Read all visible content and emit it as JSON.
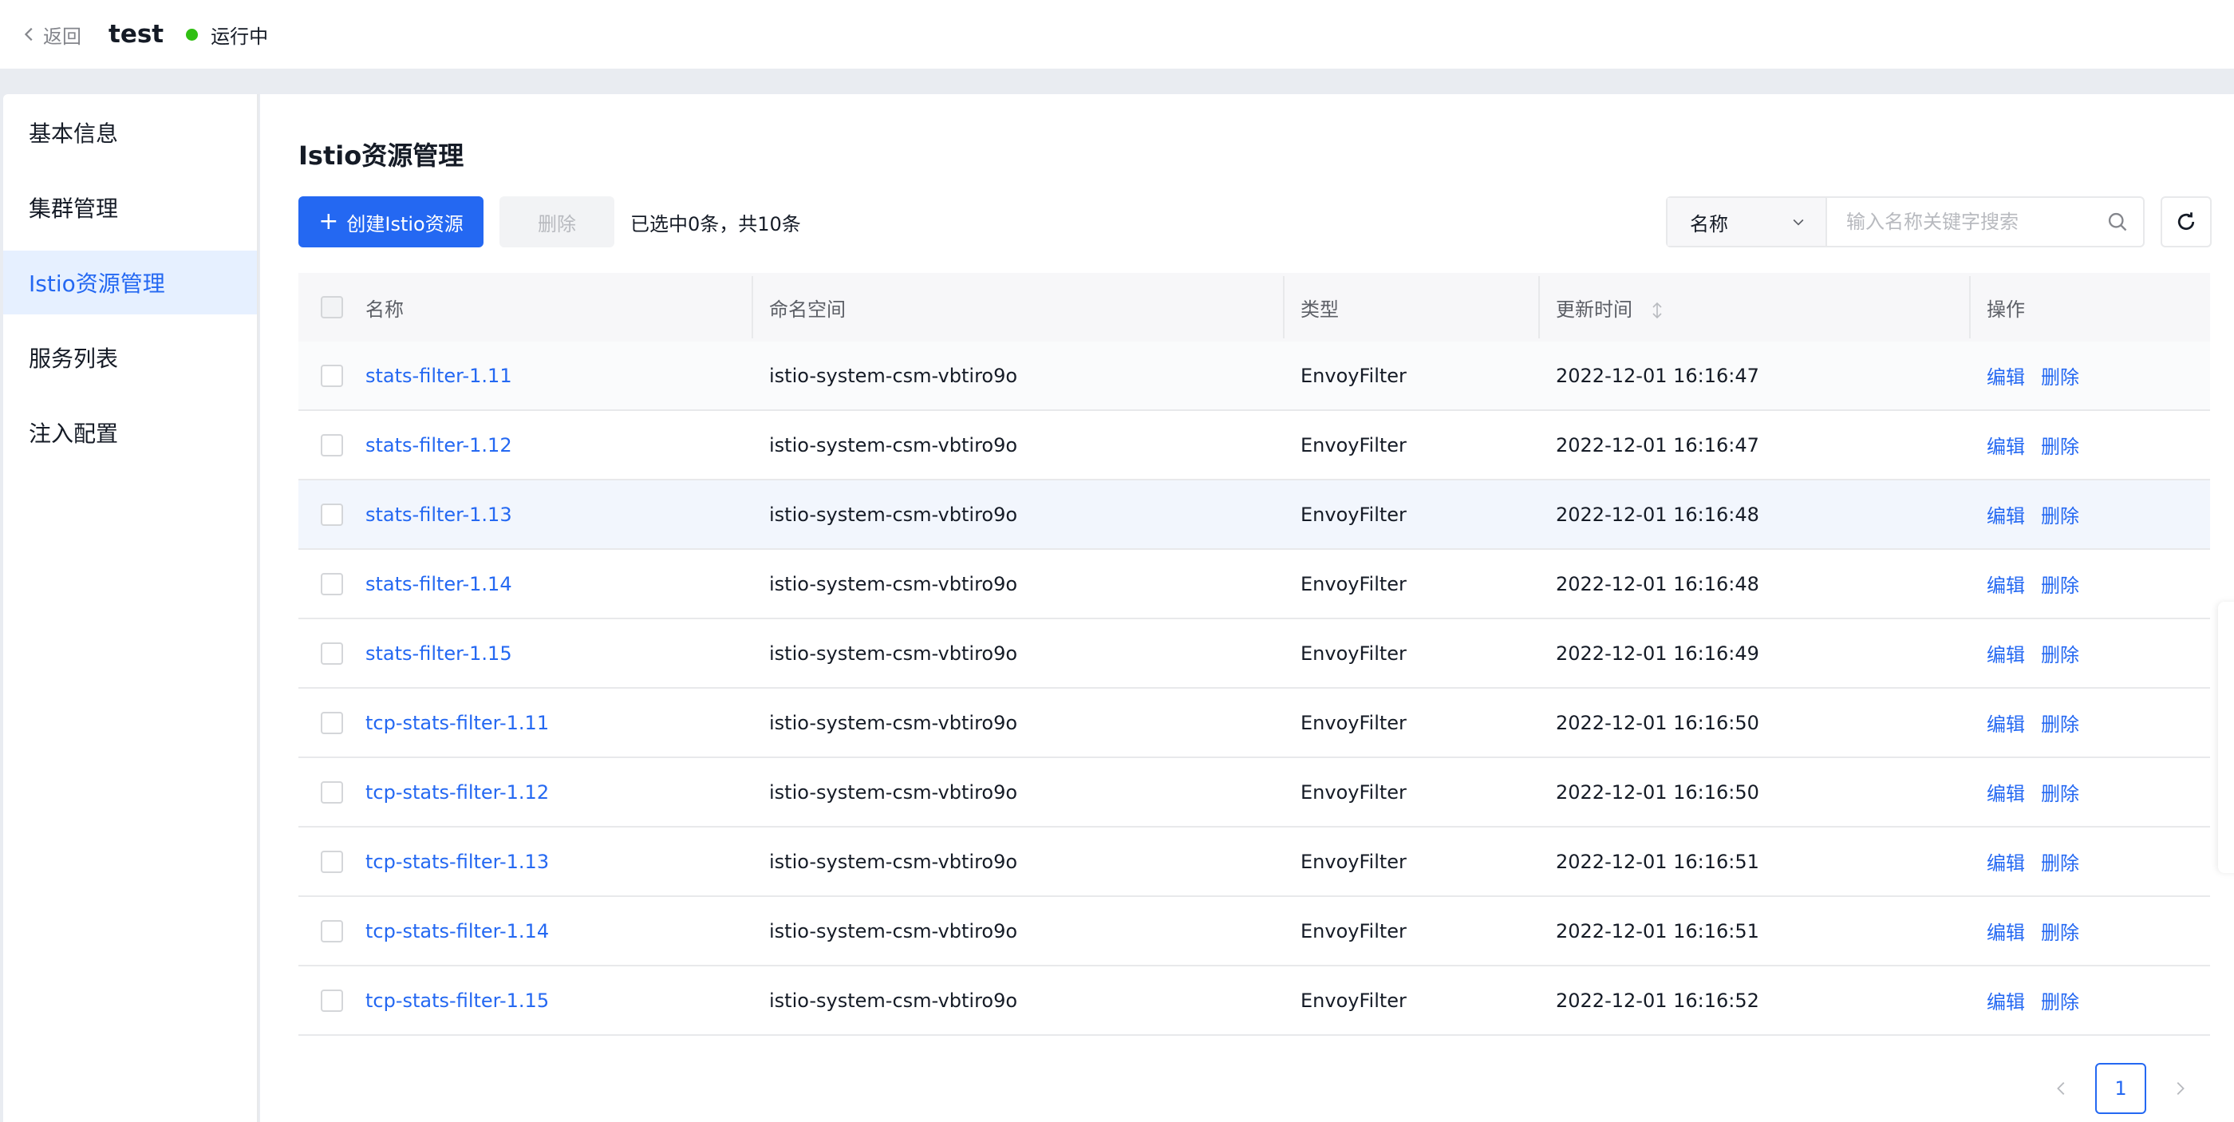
{
  "header": {
    "back_label": "返回",
    "title": "test",
    "status": "运行中",
    "status_color": "#30bf13"
  },
  "sidebar": {
    "items": [
      {
        "label": "基本信息",
        "active": false
      },
      {
        "label": "集群管理",
        "active": false
      },
      {
        "label": "Istio资源管理",
        "active": true
      },
      {
        "label": "服务列表",
        "active": false
      },
      {
        "label": "注入配置",
        "active": false
      }
    ]
  },
  "main": {
    "title": "Istio资源管理",
    "toolbar": {
      "create_label": "创建Istio资源",
      "delete_label": "删除",
      "selection_info": "已选中0条，共10条",
      "search_field": "名称",
      "search_placeholder": "输入名称关键字搜索"
    },
    "table": {
      "columns": [
        "名称",
        "命名空间",
        "类型",
        "更新时间",
        "操作"
      ],
      "rows": [
        {
          "name": "stats-filter-1.11",
          "namespace": "istio-system-csm-vbtiro9o",
          "type": "EnvoyFilter",
          "time": "2022-12-01 16:16:47"
        },
        {
          "name": "stats-filter-1.12",
          "namespace": "istio-system-csm-vbtiro9o",
          "type": "EnvoyFilter",
          "time": "2022-12-01 16:16:47"
        },
        {
          "name": "stats-filter-1.13",
          "namespace": "istio-system-csm-vbtiro9o",
          "type": "EnvoyFilter",
          "time": "2022-12-01 16:16:48"
        },
        {
          "name": "stats-filter-1.14",
          "namespace": "istio-system-csm-vbtiro9o",
          "type": "EnvoyFilter",
          "time": "2022-12-01 16:16:48"
        },
        {
          "name": "stats-filter-1.15",
          "namespace": "istio-system-csm-vbtiro9o",
          "type": "EnvoyFilter",
          "time": "2022-12-01 16:16:49"
        },
        {
          "name": "tcp-stats-filter-1.11",
          "namespace": "istio-system-csm-vbtiro9o",
          "type": "EnvoyFilter",
          "time": "2022-12-01 16:16:50"
        },
        {
          "name": "tcp-stats-filter-1.12",
          "namespace": "istio-system-csm-vbtiro9o",
          "type": "EnvoyFilter",
          "time": "2022-12-01 16:16:50"
        },
        {
          "name": "tcp-stats-filter-1.13",
          "namespace": "istio-system-csm-vbtiro9o",
          "type": "EnvoyFilter",
          "time": "2022-12-01 16:16:51"
        },
        {
          "name": "tcp-stats-filter-1.14",
          "namespace": "istio-system-csm-vbtiro9o",
          "type": "EnvoyFilter",
          "time": "2022-12-01 16:16:51"
        },
        {
          "name": "tcp-stats-filter-1.15",
          "namespace": "istio-system-csm-vbtiro9o",
          "type": "EnvoyFilter",
          "time": "2022-12-01 16:16:52"
        }
      ],
      "edit_label": "编辑",
      "delete_label": "删除"
    },
    "pagination": {
      "current_page": "1"
    }
  },
  "colors": {
    "primary": "#2468f2",
    "active_bg": "#e6f0ff",
    "page_bg": "#e9ecf1"
  }
}
